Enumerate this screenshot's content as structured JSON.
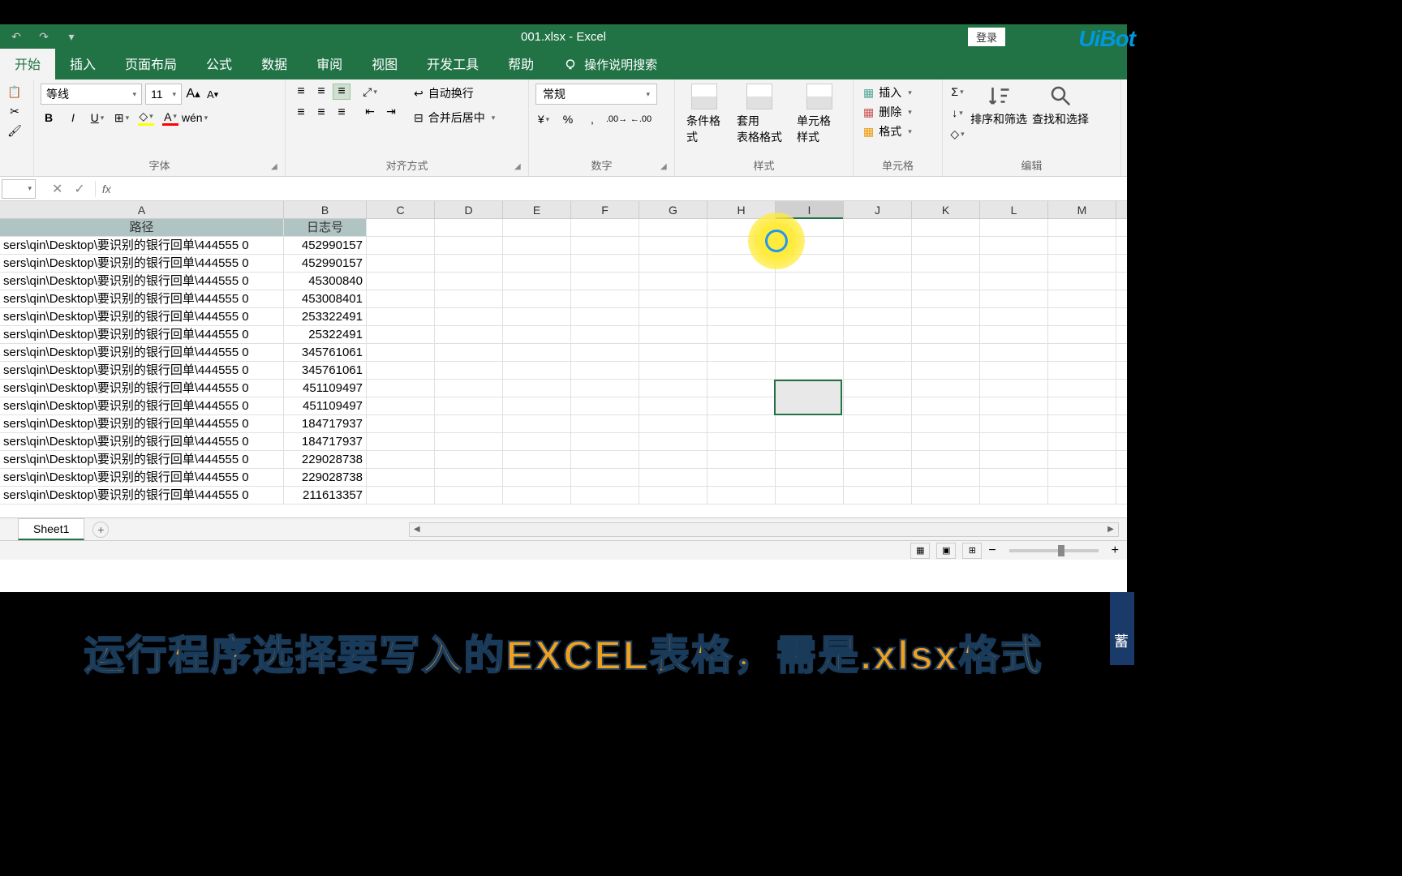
{
  "title": "001.xlsx - Excel",
  "login": "登录",
  "logo": "UiBot",
  "tabs": [
    "开始",
    "插入",
    "页面布局",
    "公式",
    "数据",
    "审阅",
    "视图",
    "开发工具",
    "帮助"
  ],
  "tab_search": "操作说明搜索",
  "ribbon": {
    "font": {
      "label": "字体",
      "name": "等线",
      "size": "11"
    },
    "align": {
      "label": "对齐方式",
      "wrap": "自动换行",
      "merge": "合并后居中"
    },
    "number": {
      "label": "数字",
      "format": "常规"
    },
    "styles": {
      "label": "样式",
      "cond": "条件格式",
      "table": "套用\n表格格式",
      "cell": "单元格样式"
    },
    "cells": {
      "label": "单元格",
      "insert": "插入",
      "delete": "删除",
      "format": "格式"
    },
    "editing": {
      "label": "编辑",
      "sort": "排序和筛选",
      "find": "查找和选择"
    }
  },
  "grid": {
    "cols": [
      "A",
      "B",
      "C",
      "D",
      "E",
      "F",
      "G",
      "H",
      "I",
      "J",
      "K",
      "L",
      "M"
    ],
    "header_row": {
      "A": "路径",
      "B": "日志号"
    },
    "rows": [
      {
        "A": "sers\\qin\\Desktop\\要识别的银行回单\\444555 0",
        "B": "452990157"
      },
      {
        "A": "sers\\qin\\Desktop\\要识别的银行回单\\444555 0",
        "B": "452990157"
      },
      {
        "A": "sers\\qin\\Desktop\\要识别的银行回单\\444555 0",
        "B": "45300840"
      },
      {
        "A": "sers\\qin\\Desktop\\要识别的银行回单\\444555 0",
        "B": "453008401"
      },
      {
        "A": "sers\\qin\\Desktop\\要识别的银行回单\\444555 0",
        "B": "253322491"
      },
      {
        "A": "sers\\qin\\Desktop\\要识别的银行回单\\444555 0",
        "B": "25322491"
      },
      {
        "A": "sers\\qin\\Desktop\\要识别的银行回单\\444555 0",
        "B": "345761061"
      },
      {
        "A": "sers\\qin\\Desktop\\要识别的银行回单\\444555 0",
        "B": "345761061"
      },
      {
        "A": "sers\\qin\\Desktop\\要识别的银行回单\\444555 0",
        "B": "451109497"
      },
      {
        "A": "sers\\qin\\Desktop\\要识别的银行回单\\444555 0",
        "B": "451109497"
      },
      {
        "A": "sers\\qin\\Desktop\\要识别的银行回单\\444555 0",
        "B": "184717937"
      },
      {
        "A": "sers\\qin\\Desktop\\要识别的银行回单\\444555 0",
        "B": "184717937"
      },
      {
        "A": "sers\\qin\\Desktop\\要识别的银行回单\\444555 0",
        "B": "229028738"
      },
      {
        "A": "sers\\qin\\Desktop\\要识别的银行回单\\444555 0",
        "B": "229028738"
      },
      {
        "A": "sers\\qin\\Desktop\\要识别的银行回单\\444555 0",
        "B": "211613357"
      }
    ]
  },
  "sheet_name": "Sheet1",
  "caption": "运行程序选择要写入的EXCEL表格，需是.xlsx格式",
  "side_char": "蓄"
}
